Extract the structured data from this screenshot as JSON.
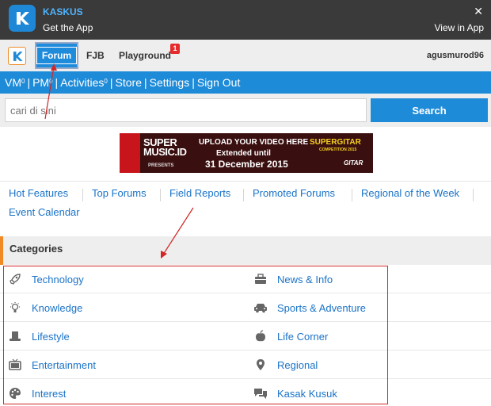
{
  "app_banner": {
    "name": "KASKUS",
    "subtitle": "Get the App",
    "close": "✕",
    "view_label": "View in App"
  },
  "topnav": {
    "tabs": [
      {
        "label": "Forum"
      },
      {
        "label": "FJB"
      },
      {
        "label": "Playground",
        "badge": "1"
      }
    ],
    "username": "agusmurod96"
  },
  "userbar": {
    "items": [
      {
        "label": "VM",
        "sup": "0"
      },
      {
        "label": "PM",
        "sup": "0"
      },
      {
        "label": "Activities",
        "sup": "0"
      },
      {
        "label": "Store"
      },
      {
        "label": "Settings"
      },
      {
        "label": "Sign Out"
      }
    ]
  },
  "search": {
    "placeholder": "cari di sini",
    "button_label": "Search"
  },
  "ad": {
    "brand_line1": "SUPER",
    "brand_line2": "MUSIC.ID",
    "presents": "PRESENTS",
    "line1": "UPLOAD YOUR VIDEO HERE",
    "line2": "Extended until",
    "line3": "31 December 2015",
    "right_title": "SUPERGITAR",
    "right_sub": "COMPETITION 2015",
    "right_logo": "GITAR"
  },
  "features": {
    "items": [
      "Hot Features",
      "Top Forums",
      "Field Reports",
      "Promoted Forums",
      "Regional of the Week",
      "Event Calendar"
    ]
  },
  "categories": {
    "title": "Categories",
    "left": [
      {
        "label": "Technology",
        "icon": "rocket-icon"
      },
      {
        "label": "Knowledge",
        "icon": "lightbulb-icon"
      },
      {
        "label": "Lifestyle",
        "icon": "top-hat-icon"
      },
      {
        "label": "Entertainment",
        "icon": "tv-icon"
      },
      {
        "label": "Interest",
        "icon": "palette-icon"
      }
    ],
    "right": [
      {
        "label": "News & Info",
        "icon": "briefcase-icon"
      },
      {
        "label": "Sports & Adventure",
        "icon": "car-icon"
      },
      {
        "label": "Life Corner",
        "icon": "apple-icon"
      },
      {
        "label": "Regional",
        "icon": "map-pin-icon"
      },
      {
        "label": "Kasak Kusuk",
        "icon": "chat-bubbles-icon"
      }
    ]
  },
  "colors": {
    "brand_blue": "#1e8bd8",
    "accent_orange": "#f08a24",
    "annotation_red": "#d22626",
    "banner_dark": "#3a3a3a"
  }
}
